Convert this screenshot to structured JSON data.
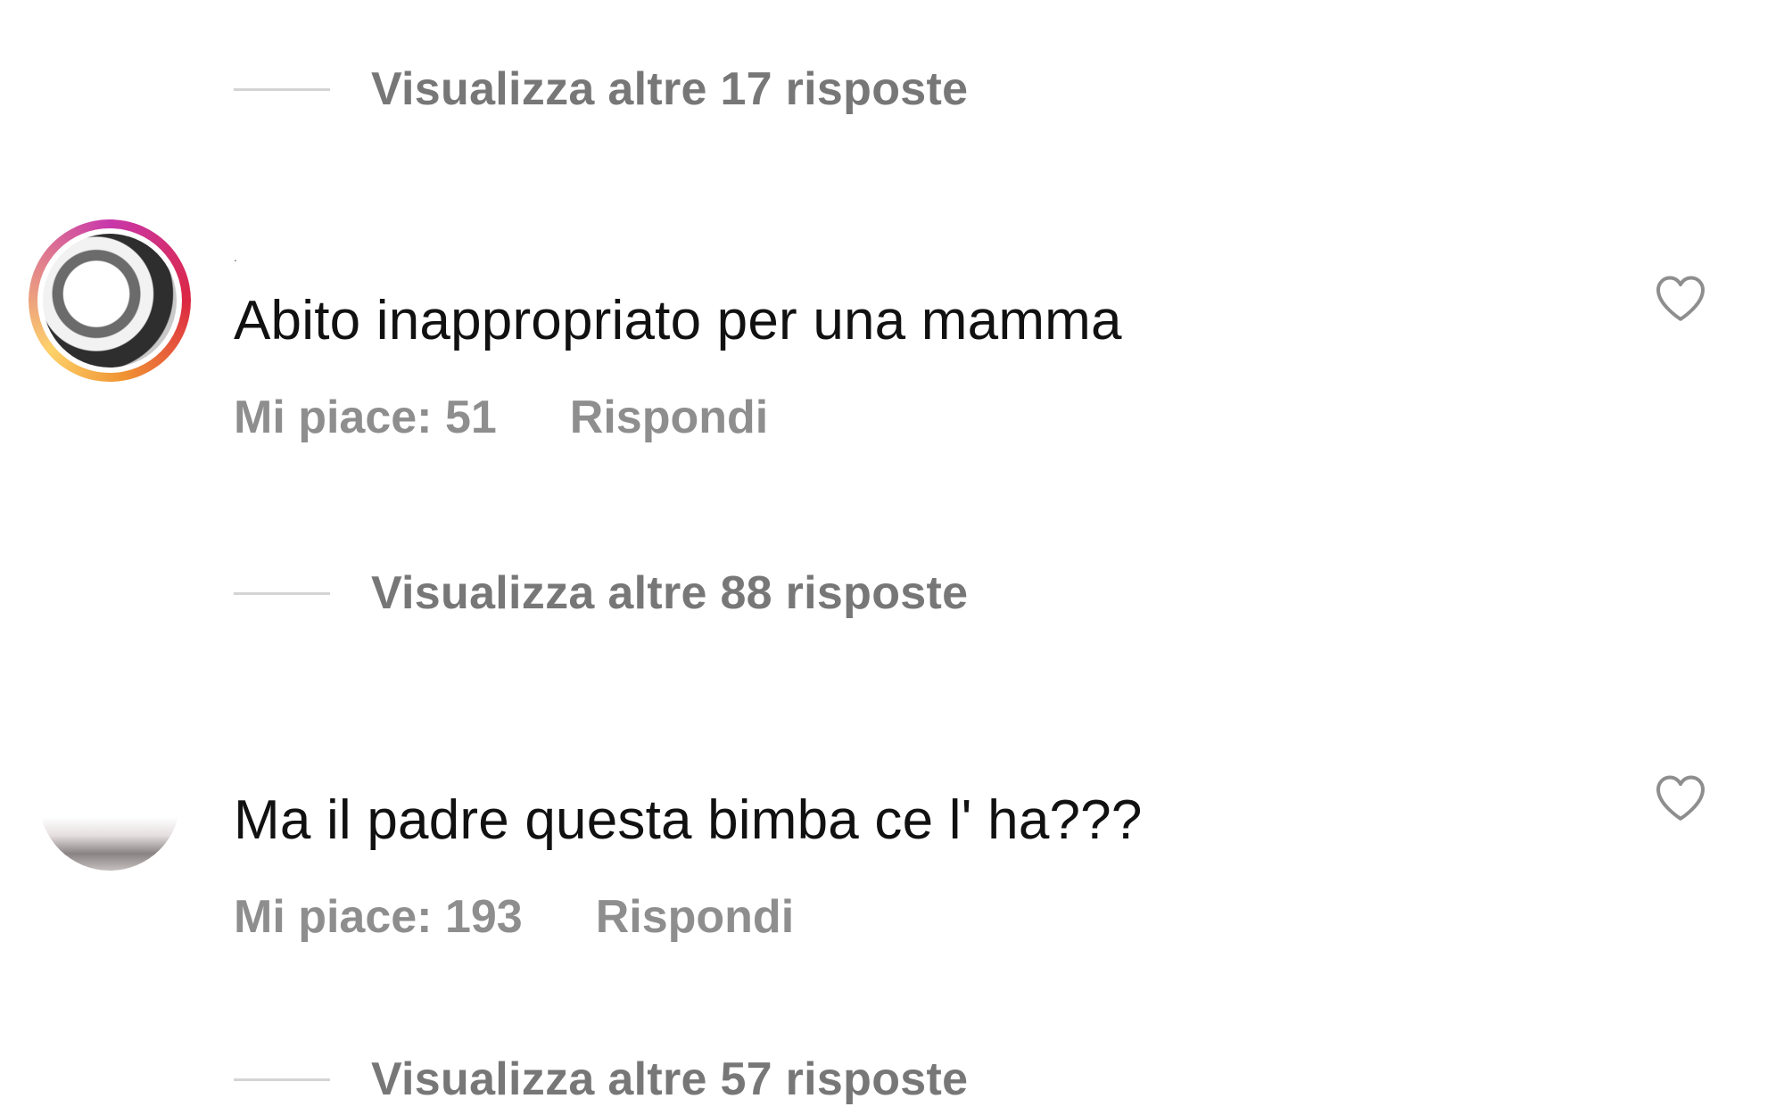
{
  "thread": {
    "view_replies_top": "Visualizza altre 17 risposte",
    "comments": [
      {
        "username": ".",
        "text": "Abito inappropriato per una mamma",
        "likes": "Mi piace: 51",
        "reply": "Rispondi",
        "view_replies": "Visualizza altre 88 risposte"
      },
      {
        "username": "",
        "text": "Ma il padre questa bimba ce l' ha???",
        "likes": "Mi piace: 193",
        "reply": "Rispondi",
        "view_replies": "Visualizza altre 57 risposte"
      }
    ]
  },
  "icons": {
    "like": "heart-outline-icon"
  },
  "colors": {
    "secondary_text": "#8e8e8e",
    "primary_text": "#111111",
    "divider": "#d4d4d4",
    "story_ring": [
      "#c837ab",
      "#dc2743",
      "#f09433",
      "#fdd26a"
    ]
  }
}
